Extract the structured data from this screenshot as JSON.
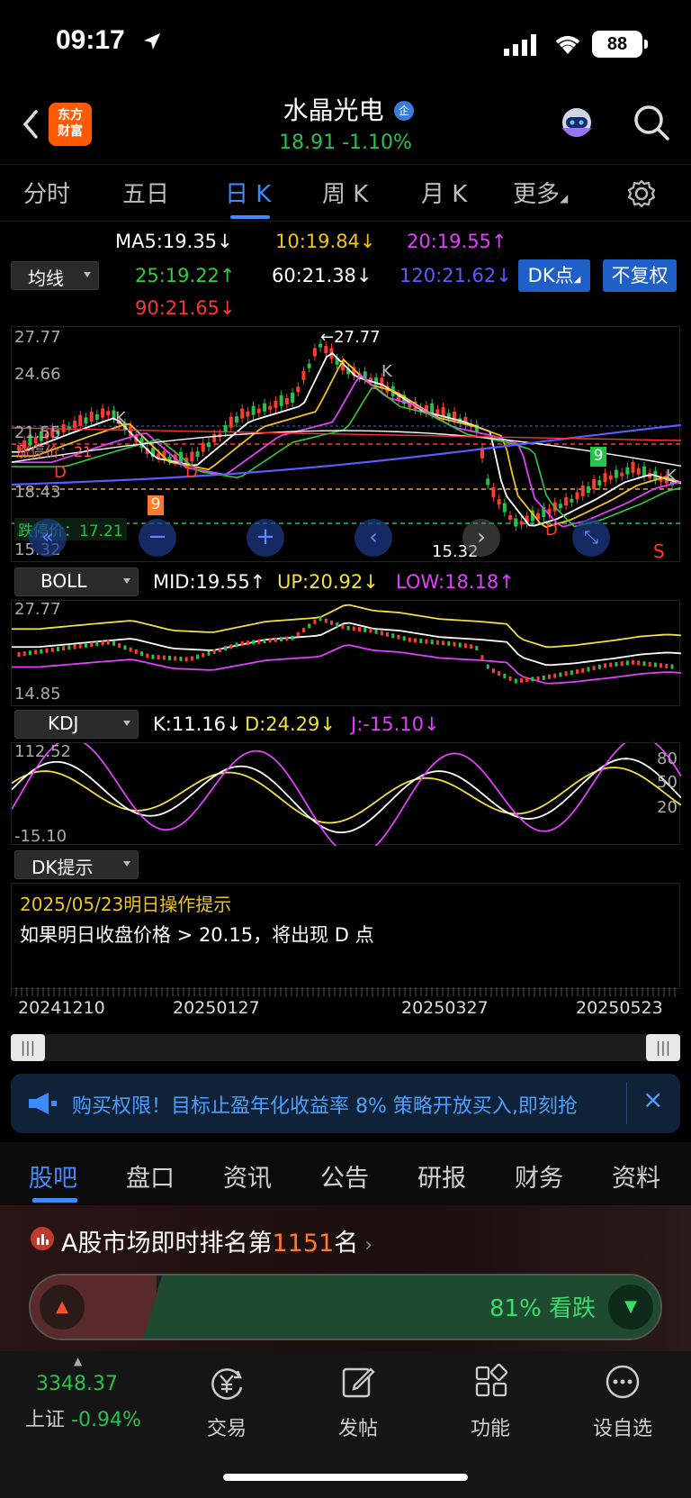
{
  "status": {
    "time": "09:17",
    "battery": "88"
  },
  "header": {
    "logo_line1": "东方",
    "logo_line2": "财富",
    "stock_name": "水晶光电",
    "badge": "企",
    "price": "18.91",
    "change": "-1.10%"
  },
  "period_tabs": [
    "分时",
    "五日",
    "日 K",
    "周 K",
    "月 K",
    "更多"
  ],
  "ma": {
    "selector": "均线",
    "ma5": "MA5:19.35↓",
    "ma10": "10:19.84↓",
    "ma20": "20:19.55↑",
    "ma25": "25:19.22↑",
    "ma60": "60:21.38↓",
    "ma120": "120:21.62↓",
    "ma90": "90:21.65↓",
    "dk_btn": "DK点",
    "fq_btn": "不复权"
  },
  "main_chart": {
    "y_top": "27.77",
    "y_2": "24.66",
    "y_3": "21.55",
    "y_4": "18.43",
    "y_bottom": "15.32",
    "max_label": "←27.77",
    "min_label": "15.32",
    "limit_down": "跌停价：17.21",
    "limit_up_label": "涨停价：21",
    "signal_d": "D",
    "signal_k": "K",
    "signal_s": "S",
    "nine": "9"
  },
  "boll": {
    "selector": "BOLL",
    "mid": "MID:19.55↑",
    "up": "UP:20.92↓",
    "low": "LOW:18.18↑",
    "y_top": "27.77",
    "y_bottom": "14.85"
  },
  "kdj": {
    "selector": "KDJ",
    "k": "K:11.16↓",
    "d": "D:24.29↓",
    "j": "J:-15.10↓",
    "y_top": "112.52",
    "y_bottom": "-15.10",
    "r80": "80",
    "r50": "50",
    "r20": "20"
  },
  "dk_tip": {
    "selector": "DK提示",
    "line1": "2025/05/23明日操作提示",
    "line2": "如果明日收盘价格 > 20.15，将出现 D 点"
  },
  "dates": [
    "20241210",
    "20250127",
    "20250327",
    "20250523"
  ],
  "banner": {
    "text": "购买权限！目标止盈年化收益率 8% 策略开放买入,即刻抢"
  },
  "bottom_tabs": [
    "股吧",
    "盘口",
    "资讯",
    "公告",
    "研报",
    "财务",
    "资料"
  ],
  "rank": {
    "prefix": "A股市场即时排名第",
    "num": "1151",
    "suffix": "名",
    "sentiment": "81%  看跌"
  },
  "nav": {
    "index_value": "3348.37",
    "index_name": "上证",
    "index_change": "-0.94%",
    "items": [
      "交易",
      "发帖",
      "功能",
      "设自选"
    ]
  },
  "colors": {
    "up": "#ff3b30",
    "down": "#27c24c",
    "accent": "#3d8bff",
    "ma5": "#ffffff",
    "ma10": "#f0c419",
    "ma20": "#e040fb",
    "ma25": "#2ecc40",
    "ma60": "#ffffff",
    "ma120": "#5b5bff",
    "ma90": "#ff3333"
  }
}
